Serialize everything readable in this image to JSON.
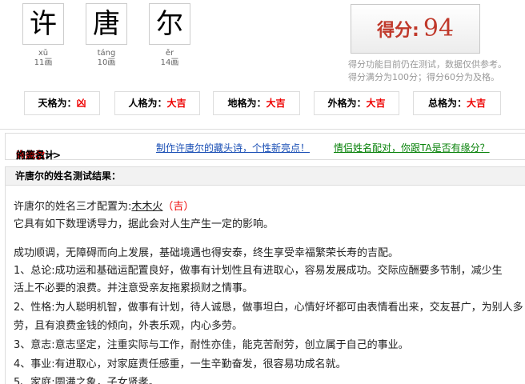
{
  "name_chars": [
    {
      "char": "许",
      "pinyin": "xǔ",
      "strokes": "11画"
    },
    {
      "char": "唐",
      "pinyin": "táng",
      "strokes": "10画"
    },
    {
      "char": "尔",
      "pinyin": "ěr",
      "strokes": "14画"
    }
  ],
  "score": {
    "label": "得分:",
    "value": "94"
  },
  "score_notes": [
    "得分功能目前仍在测试，数据仅供参考。",
    "得分满分为100分；得分60分为及格。"
  ],
  "ge": [
    {
      "label": "天格为：",
      "value": "凶"
    },
    {
      "label": "人格为：",
      "value": "大吉"
    },
    {
      "label": "地格为：",
      "value": "大吉"
    },
    {
      "label": "外格为：",
      "value": "大吉"
    },
    {
      "label": "总格为：",
      "value": "大吉"
    }
  ],
  "links": {
    "design_prefix": "点此设计",
    "design_name": "许唐尔",
    "design_suffix": "的签名>>",
    "poem": "制作许唐尔的藏头诗，个性新亮点！",
    "pair": "情侣姓名配对，你跟TA是否有缘分？"
  },
  "result": {
    "header": "许唐尔的姓名测试结果：",
    "sancai_prefix": "许唐尔的姓名三才配置为:",
    "sancai_value": "木木火",
    "sancai_tag": "（吉）",
    "lines": [
      "它具有如下数理诱导力，据此会对人生产生一定的影响。",
      "成功顺调，无障碍而向上发展，基础境遇也得安泰，终生享受幸福繁荣长寿的吉配。",
      "1、总论:成功运和基础运配置良好，做事有计划性且有进取心，容易发展成功。交际应酬要多节制，减少生",
      "活上不必要的浪费。并注意受亲友拖累损财之情事。",
      "2、性格:为人聪明机智，做事有计划，待人诚恳，做事坦白，心情好坏都可由表情看出来，交友甚广，为别人多",
      "劳，且有浪费金钱的倾向，外表乐观，内心多劳。",
      "3、意志:意志坚定，注重实际与工作，耐性亦佳，能克苦耐劳，创立属于自己的事业。",
      "4、事业:有进取心，对家庭责任感重，一生辛勤奋发，很容易功成名就。",
      "5、家庭:圆满之象，子女贤孝。"
    ]
  }
}
